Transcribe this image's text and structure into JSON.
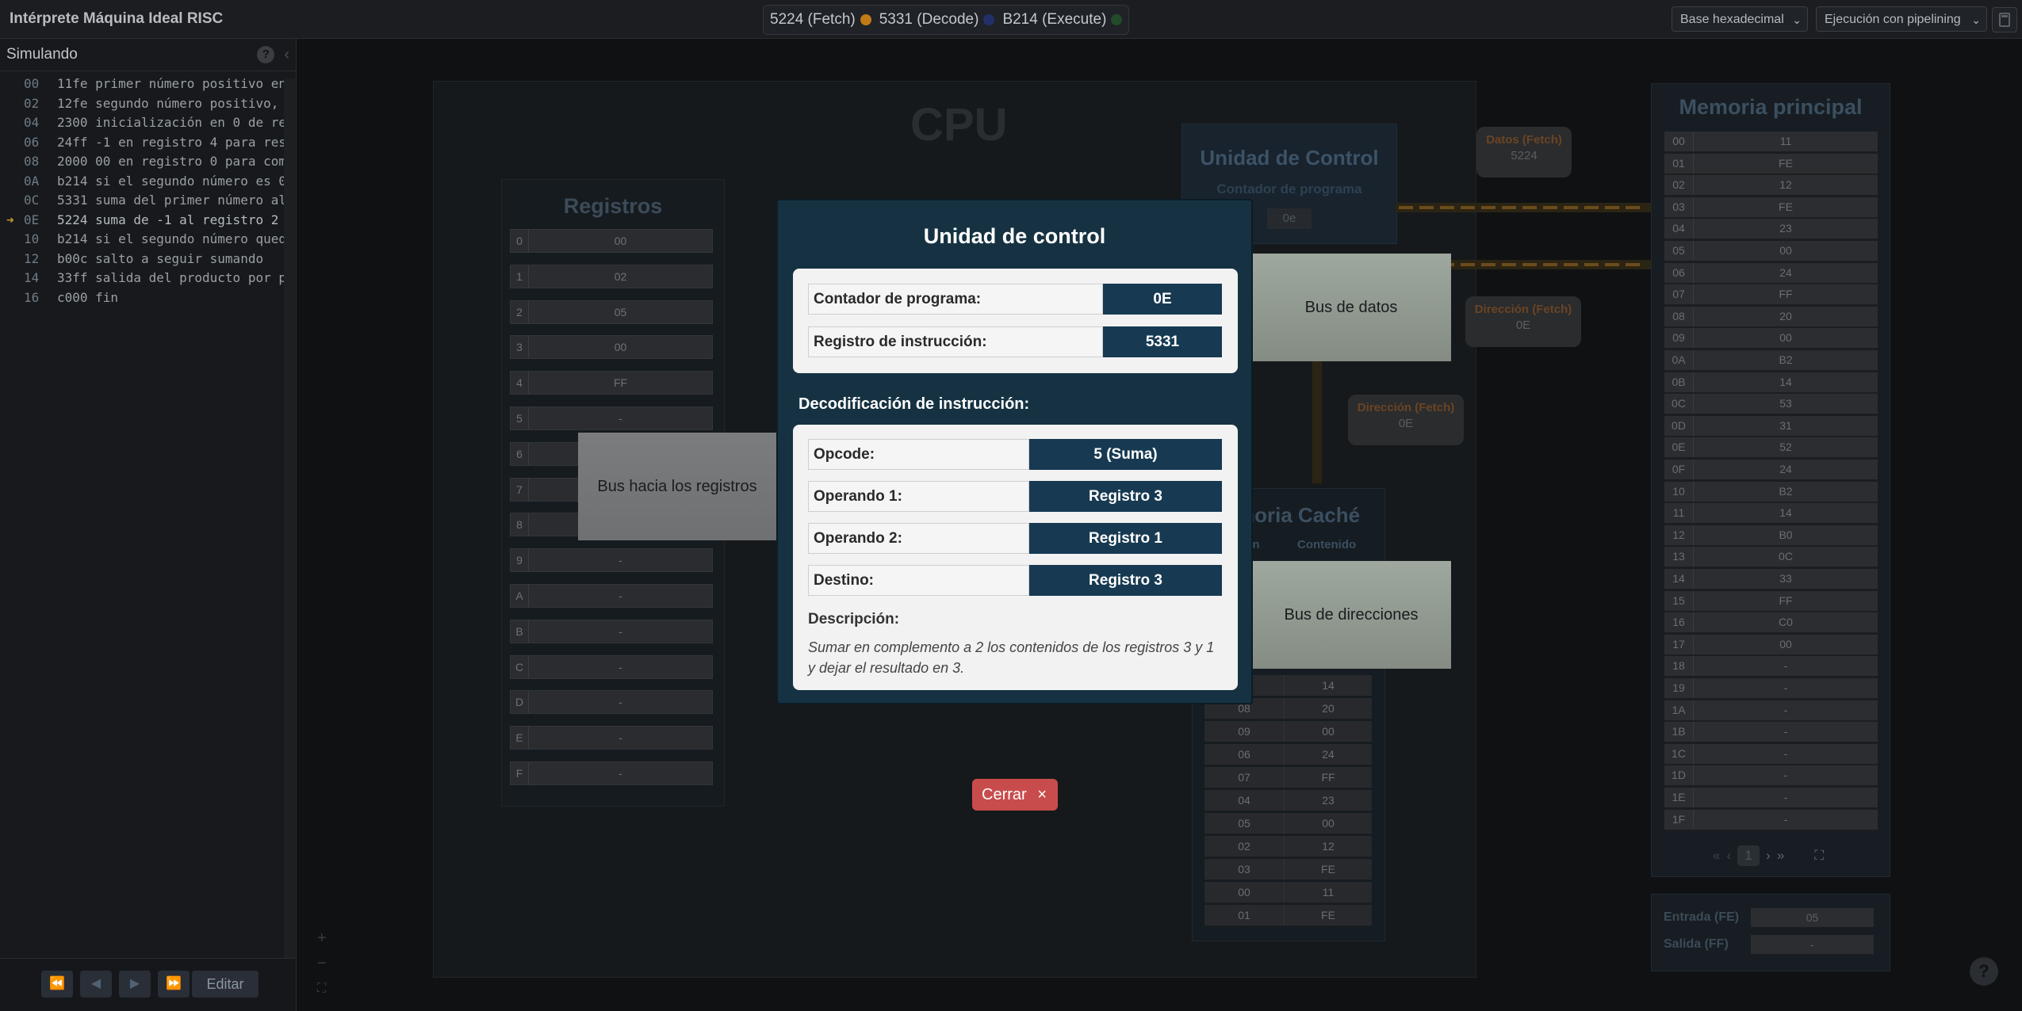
{
  "app_title": "Intérprete Máquina Ideal RISC",
  "pipeline": [
    {
      "label": "5224 (Fetch)",
      "color": "#c17a18"
    },
    {
      "label": "5331 (Decode)",
      "color": "#22306a"
    },
    {
      "label": "B214 (Execute)",
      "color": "#234a2a"
    }
  ],
  "base_select": "Base hexadecimal",
  "exec_select": "Ejecución con pipelining",
  "left_panel": {
    "title": "Simulando",
    "help_icon": "?",
    "collapse_icon": "‹",
    "current_line": 7,
    "code": [
      {
        "addr": "00",
        "text": "11fe primer número positivo en"
      },
      {
        "addr": "02",
        "text": "12fe segundo número positivo,"
      },
      {
        "addr": "04",
        "text": "2300 inicialización en 0 de re"
      },
      {
        "addr": "06",
        "text": "24ff -1 en registro 4 para res"
      },
      {
        "addr": "08",
        "text": "2000 00 en registro 0 para com"
      },
      {
        "addr": "0A",
        "text": "b214 si el segundo número es 0"
      },
      {
        "addr": "0C",
        "text": "5331 suma del primer número al"
      },
      {
        "addr": "0E",
        "text": "5224 suma de -1 al registro 2"
      },
      {
        "addr": "10",
        "text": "b214 si el segundo número qued"
      },
      {
        "addr": "12",
        "text": "b00c salto a seguir sumando"
      },
      {
        "addr": "14",
        "text": "33ff salida del producto por p"
      },
      {
        "addr": "16",
        "text": "c000 fin"
      }
    ],
    "controls": [
      "⏪",
      "◀",
      "▶",
      "⏩"
    ],
    "edit_label": "Editar"
  },
  "cpu": {
    "title": "CPU",
    "registers_title": "Registros",
    "registers": [
      {
        "k": "0",
        "v": "00"
      },
      {
        "k": "1",
        "v": "02"
      },
      {
        "k": "2",
        "v": "05"
      },
      {
        "k": "3",
        "v": "00"
      },
      {
        "k": "4",
        "v": "FF"
      },
      {
        "k": "5",
        "v": "-"
      },
      {
        "k": "6",
        "v": "-"
      },
      {
        "k": "7",
        "v": "-"
      },
      {
        "k": "8",
        "v": "-"
      },
      {
        "k": "9",
        "v": "-"
      },
      {
        "k": "A",
        "v": "-"
      },
      {
        "k": "B",
        "v": "-"
      },
      {
        "k": "C",
        "v": "-"
      },
      {
        "k": "D",
        "v": "-"
      },
      {
        "k": "E",
        "v": "-"
      },
      {
        "k": "F",
        "v": "-"
      }
    ],
    "control_unit_title": "Unidad de Control",
    "pc_label": "Contador de programa",
    "pc_value": "0e",
    "cache_title": "moria Caché",
    "cache_head_addr": "ión",
    "cache_head_content": "Contenido",
    "cache_rows": [
      {
        "a": "",
        "c": "14"
      },
      {
        "a": "08",
        "c": "20"
      },
      {
        "a": "09",
        "c": "00"
      },
      {
        "a": "06",
        "c": "24"
      },
      {
        "a": "07",
        "c": "FF"
      },
      {
        "a": "04",
        "c": "23"
      },
      {
        "a": "05",
        "c": "00"
      },
      {
        "a": "02",
        "c": "12"
      },
      {
        "a": "03",
        "c": "FE"
      },
      {
        "a": "00",
        "c": "11"
      },
      {
        "a": "01",
        "c": "FE"
      }
    ],
    "data_tooltip": {
      "title": "Datos (Fetch)",
      "value": "5224"
    },
    "addr_tooltip1": {
      "title": "Dirección (Fetch)",
      "value": "0E"
    },
    "addr_tooltip2": {
      "title": "Dirección (Fetch)",
      "value": "0E"
    },
    "bus_registers": "Bus hacia los registros",
    "bus_data": "Bus de datos",
    "bus_address": "Bus de direcciones"
  },
  "memory": {
    "title": "Memoria principal",
    "rows": [
      {
        "a": "00",
        "c": "11"
      },
      {
        "a": "01",
        "c": "FE"
      },
      {
        "a": "02",
        "c": "12"
      },
      {
        "a": "03",
        "c": "FE"
      },
      {
        "a": "04",
        "c": "23"
      },
      {
        "a": "05",
        "c": "00"
      },
      {
        "a": "06",
        "c": "24"
      },
      {
        "a": "07",
        "c": "FF"
      },
      {
        "a": "08",
        "c": "20"
      },
      {
        "a": "09",
        "c": "00"
      },
      {
        "a": "0A",
        "c": "B2"
      },
      {
        "a": "0B",
        "c": "14"
      },
      {
        "a": "0C",
        "c": "53"
      },
      {
        "a": "0D",
        "c": "31"
      },
      {
        "a": "0E",
        "c": "52"
      },
      {
        "a": "0F",
        "c": "24"
      },
      {
        "a": "10",
        "c": "B2"
      },
      {
        "a": "11",
        "c": "14"
      },
      {
        "a": "12",
        "c": "B0"
      },
      {
        "a": "13",
        "c": "0C"
      },
      {
        "a": "14",
        "c": "33"
      },
      {
        "a": "15",
        "c": "FF"
      },
      {
        "a": "16",
        "c": "C0"
      },
      {
        "a": "17",
        "c": "00"
      },
      {
        "a": "18",
        "c": "-"
      },
      {
        "a": "19",
        "c": "-"
      },
      {
        "a": "1A",
        "c": "-"
      },
      {
        "a": "1B",
        "c": "-"
      },
      {
        "a": "1C",
        "c": "-"
      },
      {
        "a": "1D",
        "c": "-"
      },
      {
        "a": "1E",
        "c": "-"
      },
      {
        "a": "1F",
        "c": "-"
      }
    ],
    "page": "1",
    "pager": {
      "first": "«",
      "prev": "‹",
      "next": "›",
      "last": "»",
      "fullscreen": "⛶"
    }
  },
  "io": {
    "input_label": "Entrada (FE)",
    "input_value": "05",
    "output_label": "Salida (FF)",
    "output_value": "-"
  },
  "zoom": {
    "in": "+",
    "out": "−",
    "fit": "⛶"
  },
  "help_fab": "?",
  "modal": {
    "title": "Unidad de control",
    "pc_label": "Contador de programa:",
    "pc_value": "0E",
    "ir_label": "Registro de instrucción:",
    "ir_value": "5331",
    "decode_title": "Decodificación de instrucción:",
    "decode": [
      {
        "label": "Opcode:",
        "value": "5 (Suma)"
      },
      {
        "label": "Operando 1:",
        "value": "Registro 3"
      },
      {
        "label": "Operando 2:",
        "value": "Registro 1"
      },
      {
        "label": "Destino:",
        "value": "Registro 3"
      }
    ],
    "desc_label": "Descripción:",
    "desc_text": "Sumar en complemento a 2 los contenidos de los registros 3 y 1 y dejar el resultado en 3.",
    "close_label": "Cerrar",
    "close_icon": "×"
  }
}
